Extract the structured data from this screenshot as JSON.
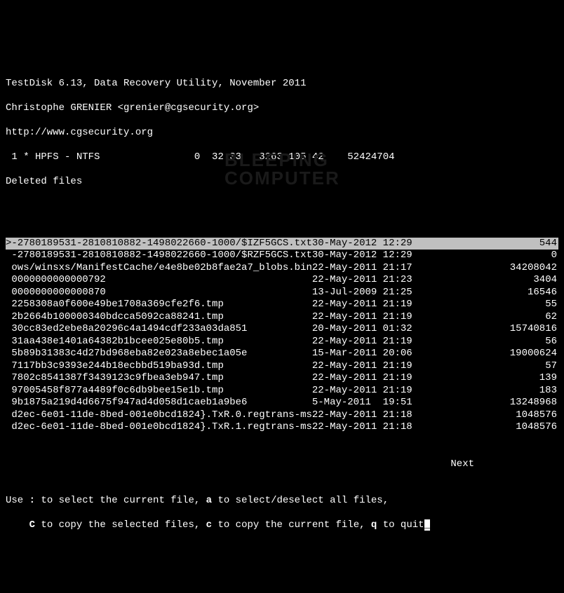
{
  "header": {
    "title": "TestDisk 6.13, Data Recovery Utility, November 2011",
    "author": "Christophe GRENIER <grenier@cgsecurity.org>",
    "url": "http://www.cgsecurity.org",
    "partition": " 1 * HPFS - NTFS                0  32 33   3263 105 42    52424704",
    "mode": "Deleted files"
  },
  "files": [
    {
      "selected": true,
      "name": ">-2780189531-2810810882-1498022660-1000/$IZF5GCS.txt",
      "date": "30-May-2012",
      "time": "12:29",
      "size": "544"
    },
    {
      "selected": false,
      "name": " -2780189531-2810810882-1498022660-1000/$RZF5GCS.txt",
      "date": "30-May-2012",
      "time": "12:29",
      "size": "0"
    },
    {
      "selected": false,
      "name": " ows/winsxs/ManifestCache/e4e8be02b8fae2a7_blobs.bin",
      "date": "22-May-2011",
      "time": "21:17",
      "size": "34208042"
    },
    {
      "selected": false,
      "name": " 0000000000000792",
      "date": "22-May-2011",
      "time": "21:23",
      "size": "3404"
    },
    {
      "selected": false,
      "name": " 0000000000000870",
      "date": "13-Jul-2009",
      "time": "21:25",
      "size": "16546"
    },
    {
      "selected": false,
      "name": " 2258308a0f600e49be1708a369cfe2f6.tmp",
      "date": "22-May-2011",
      "time": "21:19",
      "size": "55"
    },
    {
      "selected": false,
      "name": " 2b2664b100000340bdcca5092ca88241.tmp",
      "date": "22-May-2011",
      "time": "21:19",
      "size": "62"
    },
    {
      "selected": false,
      "name": " 30cc83ed2ebe8a20296c4a1494cdf233a03da851",
      "date": "20-May-2011",
      "time": "01:32",
      "size": "15740816"
    },
    {
      "selected": false,
      "name": " 31aa438e1401a64382b1bcee025e80b5.tmp",
      "date": "22-May-2011",
      "time": "21:19",
      "size": "56"
    },
    {
      "selected": false,
      "name": " 5b89b31383c4d27bd968eba82e023a8ebec1a05e",
      "date": "15-Mar-2011",
      "time": "20:06",
      "size": "19000624"
    },
    {
      "selected": false,
      "name": " 7117bb3c9393e244b18ecbbd519ba93d.tmp",
      "date": "22-May-2011",
      "time": "21:19",
      "size": "57"
    },
    {
      "selected": false,
      "name": " 7802c8541387f3439123c9fbea3eb947.tmp",
      "date": "22-May-2011",
      "time": "21:19",
      "size": "139"
    },
    {
      "selected": false,
      "name": " 97005458f877a4489f0c6db9bee15e1b.tmp",
      "date": "22-May-2011",
      "time": "21:19",
      "size": "183"
    },
    {
      "selected": false,
      "name": " 9b1875a219d4d6675f947ad4d058d1caeb1a9be6",
      "date": "5-May-2011",
      "time": "19:51",
      "size": "13248968"
    },
    {
      "selected": false,
      "name": " d2ec-6e01-11de-8bed-001e0bcd1824}.TxR.0.regtrans-ms",
      "date": "22-May-2011",
      "time": "21:18",
      "size": "1048576"
    },
    {
      "selected": false,
      "name": " d2ec-6e01-11de-8bed-001e0bcd1824}.TxR.1.regtrans-ms",
      "date": "22-May-2011",
      "time": "21:18",
      "size": "1048576"
    }
  ],
  "pager": {
    "next": "Next"
  },
  "help": {
    "line1_a": "Use ",
    "line1_b": ":",
    "line1_c": " to select the current file, ",
    "line1_d": "a",
    "line1_e": " to select/deselect all files,",
    "line2_a": "    ",
    "line2_b": "C",
    "line2_c": " to copy the selected files, ",
    "line2_d": "c",
    "line2_e": " to copy the current file, ",
    "line2_f": "q",
    "line2_g": " to quit"
  },
  "watermark": {
    "line1": "BLEEPING",
    "line2": "COMPUTER"
  }
}
